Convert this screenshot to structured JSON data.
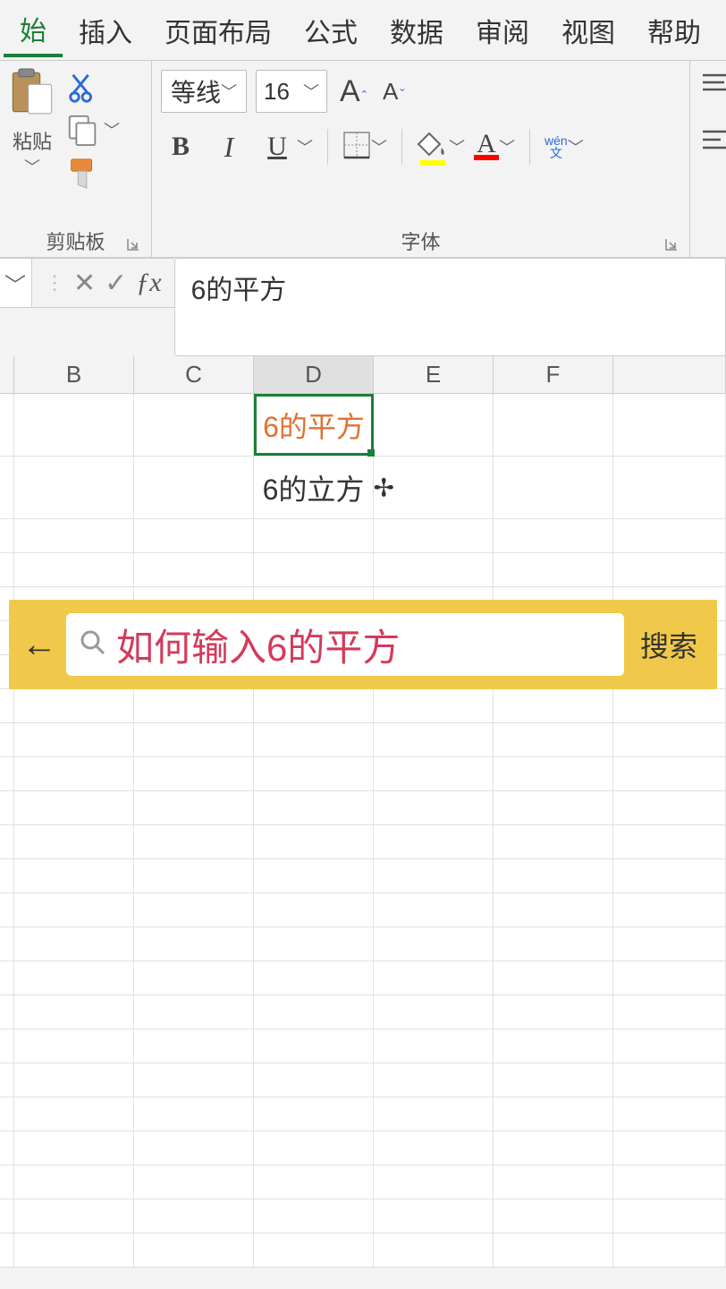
{
  "menu": {
    "items": [
      "始",
      "插入",
      "页面布局",
      "公式",
      "数据",
      "审阅",
      "视图",
      "帮助"
    ],
    "active": 0
  },
  "ribbon": {
    "clipboard": {
      "paste": "粘贴",
      "label": "剪贴板"
    },
    "font": {
      "name": "等线",
      "size": "16",
      "ruby_top": "wén",
      "ruby_bottom": "文",
      "label": "字体"
    }
  },
  "formula": {
    "value": "6的平方"
  },
  "columns": [
    "B",
    "C",
    "D",
    "E",
    "F"
  ],
  "cells": {
    "d1": "6的平方",
    "d2": "6的立方"
  },
  "search": {
    "text": "如何输入6的平方",
    "button": "搜索"
  }
}
